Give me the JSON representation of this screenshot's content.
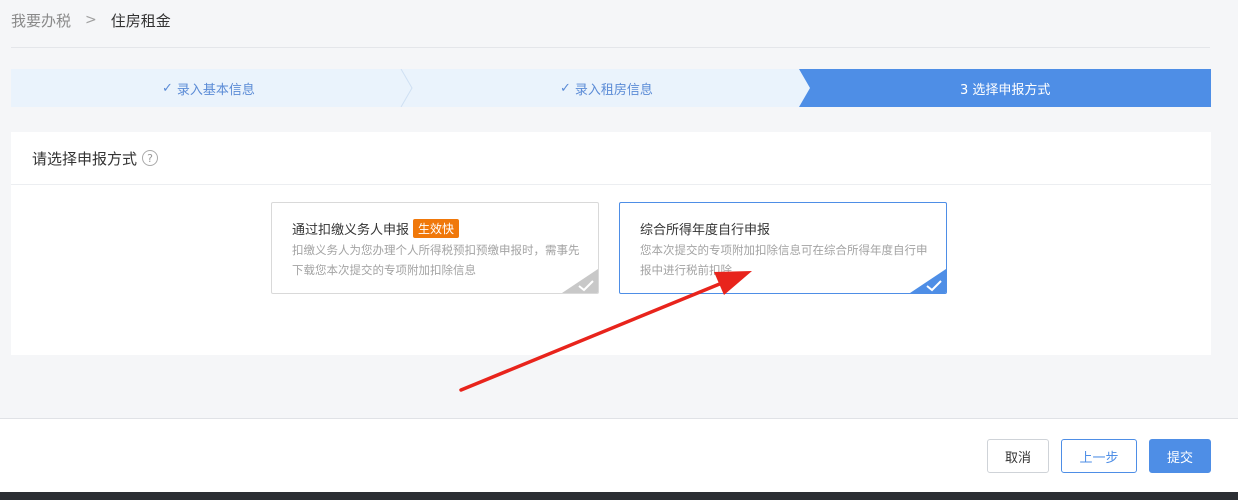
{
  "breadcrumb": {
    "parent": "我要办税",
    "separator": ">",
    "current": "住房租金"
  },
  "steps": [
    {
      "label": "录入基本信息",
      "status": "done"
    },
    {
      "label": "录入租房信息",
      "status": "done"
    },
    {
      "label": "3 选择申报方式",
      "status": "active"
    }
  ],
  "panel": {
    "title": "请选择申报方式",
    "help_icon": "?",
    "options": [
      {
        "title": "通过扣缴义务人申报",
        "badge": "生效快",
        "description": "扣缴义务人为您办理个人所得税预扣预缴申报时，需事先下载您本次提交的专项附加扣除信息",
        "selected": false
      },
      {
        "title": "综合所得年度自行申报",
        "description": "您本次提交的专项附加扣除信息可在综合所得年度自行申报中进行税前扣除",
        "selected": true
      }
    ]
  },
  "footer": {
    "cancel": "取消",
    "prev": "上一步",
    "submit": "提交"
  },
  "colors": {
    "accent": "#4e8ee6",
    "badge": "#f0780a",
    "arrow": "#e8241c"
  }
}
